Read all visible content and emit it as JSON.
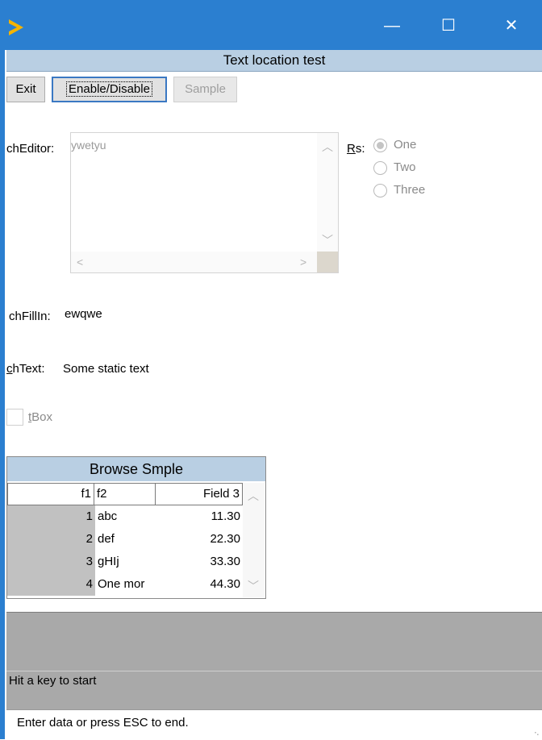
{
  "window": {
    "title": "Text location test",
    "minimize_glyph": "—",
    "maximize_glyph": "☐",
    "close_glyph": "✕"
  },
  "toolbar": {
    "exit_label": "Exit",
    "enable_label": "Enable/Disable",
    "sample_label": "Sample"
  },
  "editor": {
    "label": "chEditor:",
    "value": "ywetyu"
  },
  "radio_set": {
    "label": "Rs:",
    "options": [
      "One",
      "Two",
      "Three"
    ],
    "selected": "One"
  },
  "fill_in": {
    "label": "chFillIn:",
    "value": "ewqwe"
  },
  "static_text": {
    "label": "chText:",
    "value": "Some static text"
  },
  "toggle_box": {
    "label": "tBox",
    "checked": false
  },
  "browse": {
    "title": "Browse Smple",
    "columns": [
      "f1",
      "f2",
      "Field 3"
    ],
    "rows": [
      {
        "f1": "1",
        "f2": "abc",
        "f3": "11.30"
      },
      {
        "f1": "2",
        "f2": "def",
        "f3": "22.30"
      },
      {
        "f1": "3",
        "f2": "gHIj",
        "f3": "33.30"
      },
      {
        "f1": "4",
        "f2": "One mor",
        "f3": "44.30"
      }
    ]
  },
  "message_area": {
    "text": "Hit a key to start"
  },
  "status_bar": {
    "text": "Enter data or press ESC to end."
  },
  "colors": {
    "title_bar": "#2b7fd0",
    "header_blue": "#b9cfe3",
    "gray_area": "#a9a9a9"
  }
}
